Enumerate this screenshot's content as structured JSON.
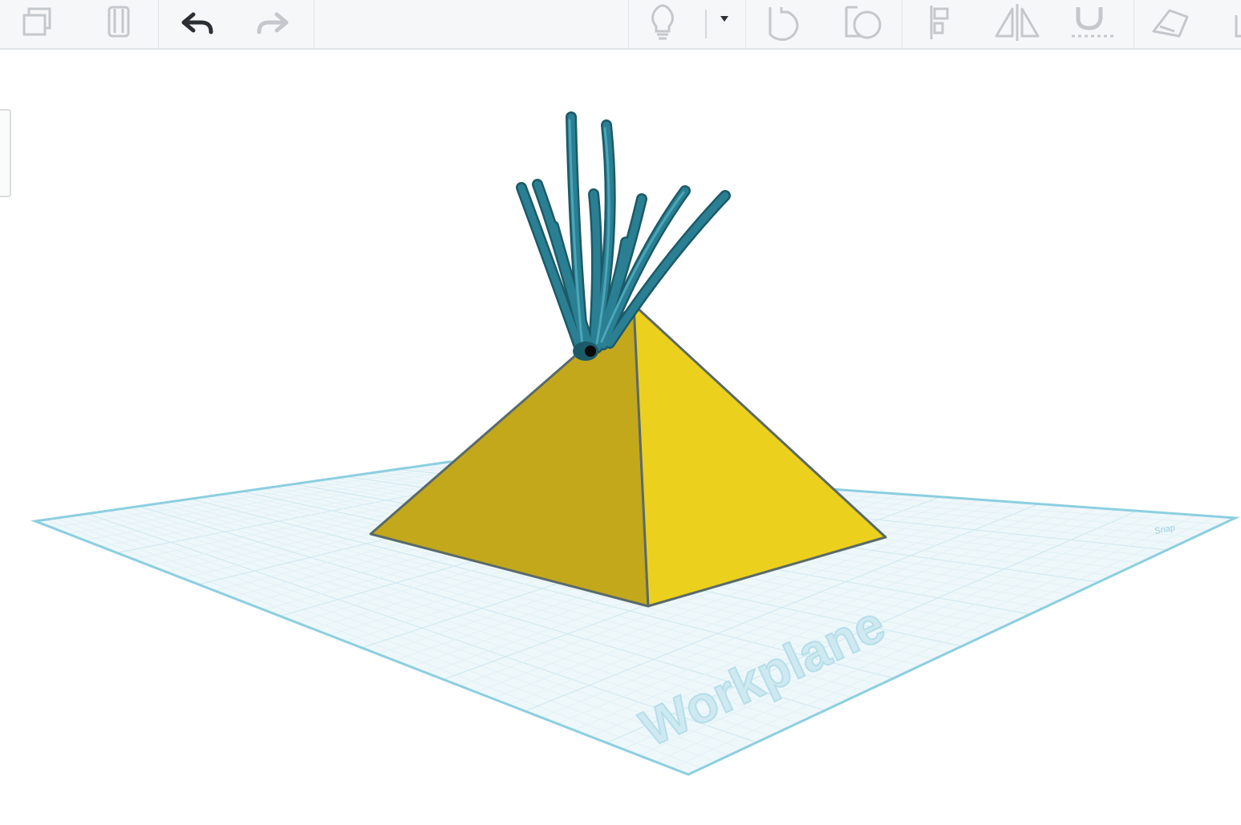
{
  "app": {
    "workplane_label": "Workplane",
    "grid_unit_label": "Snap"
  },
  "toolbar": {
    "left_tools": [
      {
        "name": "copy",
        "icon": "copy-icon",
        "enabled": false
      },
      {
        "name": "delete",
        "icon": "trash-icon",
        "enabled": false
      },
      {
        "name": "undo",
        "icon": "undo-icon",
        "enabled": true
      },
      {
        "name": "redo",
        "icon": "redo-icon",
        "enabled": false
      }
    ],
    "right_tools": [
      {
        "name": "show-all",
        "icon": "lightbulb-icon"
      },
      {
        "name": "show-dropdown",
        "icon": "chevron-down-icon"
      },
      {
        "name": "shape-solid",
        "icon": "shape-solid-icon"
      },
      {
        "name": "shape-hole",
        "icon": "shape-hole-icon"
      },
      {
        "name": "align",
        "icon": "align-icon"
      },
      {
        "name": "mirror",
        "icon": "mirror-icon"
      },
      {
        "name": "cruise",
        "icon": "magnet-icon"
      },
      {
        "name": "workplane",
        "icon": "workplane-tool-icon"
      }
    ]
  },
  "scene": {
    "pyramid_colors": {
      "left_face": "#c3a81c",
      "right_face": "#ecd01e",
      "edge": "#5a6a6a"
    },
    "accent_colors": {
      "plane_fill": "#eef7fa",
      "plane_border": "#8ccfe0",
      "tentacle": "#2a7f93",
      "tentacle_dark": "#1c5a68"
    }
  }
}
